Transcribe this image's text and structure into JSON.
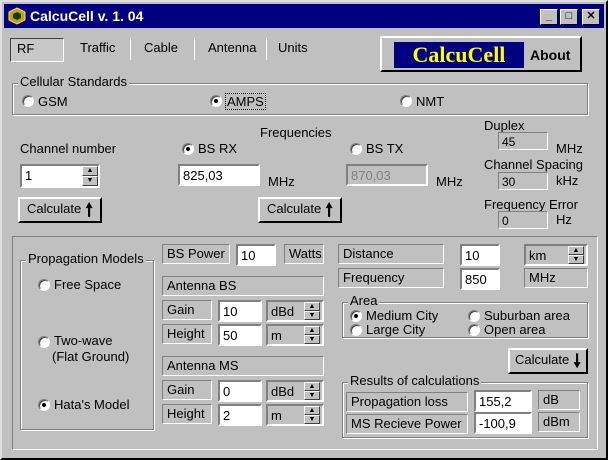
{
  "window": {
    "title": "CalcuCell v. 1. 04"
  },
  "tabs": [
    "RF",
    "Traffic",
    "Cable",
    "Antenna",
    "Units"
  ],
  "logo_text": "CalcuCell",
  "about_label": "About",
  "cellular": {
    "title": "Cellular Standards",
    "options": [
      "GSM",
      "AMPS",
      "NMT"
    ],
    "selected": "AMPS"
  },
  "channel": {
    "label": "Channel number",
    "value": "1"
  },
  "frequencies": {
    "title": "Frequencies",
    "bs_rx_label": "BS RX",
    "bs_rx_value": "825,03",
    "bs_tx_label": "BS TX",
    "bs_tx_value": "870,03",
    "unit": "MHz",
    "selected": "BS RX"
  },
  "duplex": {
    "label": "Duplex",
    "value": "45",
    "unit": "MHz"
  },
  "spacing": {
    "label": "Channel Spacing",
    "value": "30",
    "unit": "kHz"
  },
  "freq_error": {
    "label": "Frequency Error",
    "value": "0",
    "unit": "Hz"
  },
  "calculate_label": "Calculate",
  "propagation": {
    "title": "Propagation Models",
    "models": [
      "Free Space",
      "Two-wave",
      "(Flat Ground)",
      "Hata's Model"
    ],
    "selected": "Hata's Model"
  },
  "bs_power": {
    "label": "BS Power",
    "value": "10",
    "unit": "Watts"
  },
  "antenna_bs": {
    "title": "Antenna BS",
    "gain_label": "Gain",
    "gain": "10",
    "gain_unit": "dBd",
    "height_label": "Height",
    "height": "50",
    "height_unit": "m"
  },
  "antenna_ms": {
    "title": "Antenna MS",
    "gain_label": "Gain",
    "gain": "0",
    "gain_unit": "dBd",
    "height_label": "Height",
    "height": "2",
    "height_unit": "m"
  },
  "distance": {
    "label": "Distance",
    "value": "10",
    "unit": "km"
  },
  "frequency": {
    "label": "Frequency",
    "value": "850",
    "unit": "MHz"
  },
  "area": {
    "title": "Area",
    "options": [
      "Medium City",
      "Suburban area",
      "Large City",
      "Open area"
    ],
    "selected": "Medium City"
  },
  "results": {
    "title": "Results of calculations",
    "loss_label": "Propagation loss",
    "loss_value": "155,2",
    "loss_unit": "dB",
    "power_label": "MS Recieve Power",
    "power_value": "-100,9",
    "power_unit": "dBm"
  },
  "colors": {
    "titlebar": "#000080",
    "logo_bg": "#000080",
    "logo_text": "#ffff00"
  }
}
